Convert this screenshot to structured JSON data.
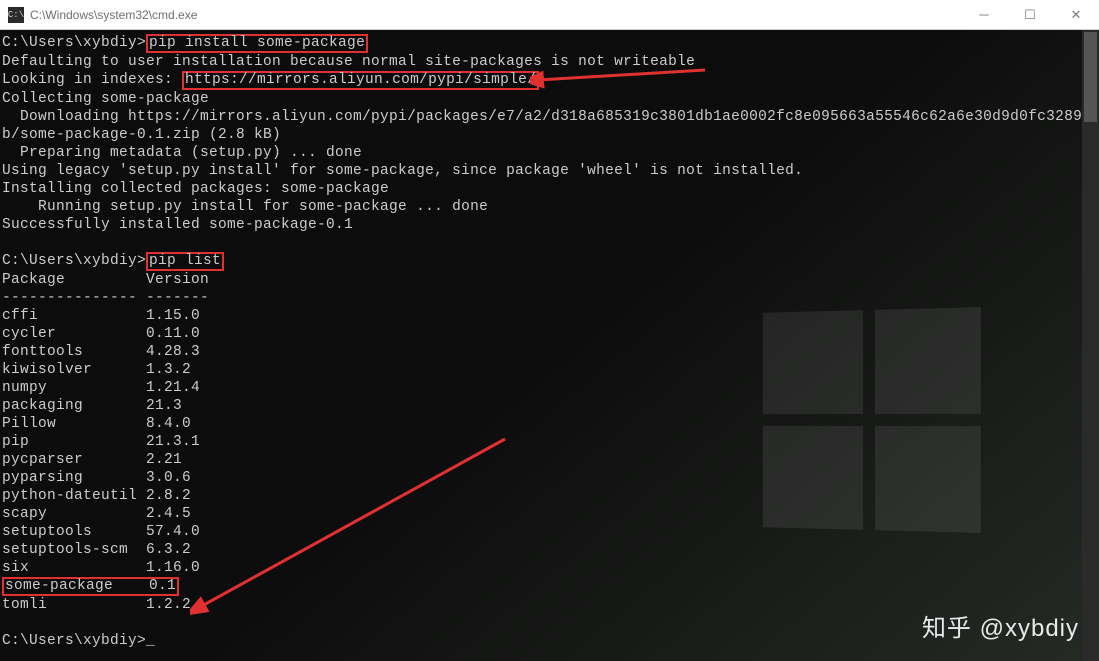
{
  "window": {
    "title": "C:\\Windows\\system32\\cmd.exe",
    "icon_label": "C:\\"
  },
  "prompt": "C:\\Users\\xybdiy>",
  "commands": {
    "install": "pip install some-package",
    "list": "pip list"
  },
  "output": {
    "install": {
      "line1": "Defaulting to user installation because normal site-packages is not writeable",
      "looking_prefix": "Looking in indexes: ",
      "index_url": "https://mirrors.aliyun.com/pypi/simple/",
      "collecting": "Collecting some-package",
      "downloading": "  Downloading https://mirrors.aliyun.com/pypi/packages/e7/a2/d318a685319c3801db1ae0002fc8e095663a55546c62a6e30d9d0fc3289",
      "downloading2": "b/some-package-0.1.zip (2.8 kB)",
      "preparing": "  Preparing metadata (setup.py) ... done",
      "legacy": "Using legacy 'setup.py install' for some-package, since package 'wheel' is not installed.",
      "installing": "Installing collected packages: some-package",
      "running": "    Running setup.py install for some-package ... done",
      "success": "Successfully installed some-package-0.1"
    },
    "list": {
      "header": "Package         Version",
      "divider": "--------------- -------",
      "packages": [
        {
          "name": "cffi",
          "ver": "1.15.0"
        },
        {
          "name": "cycler",
          "ver": "0.11.0"
        },
        {
          "name": "fonttools",
          "ver": "4.28.3"
        },
        {
          "name": "kiwisolver",
          "ver": "1.3.2"
        },
        {
          "name": "numpy",
          "ver": "1.21.4"
        },
        {
          "name": "packaging",
          "ver": "21.3"
        },
        {
          "name": "Pillow",
          "ver": "8.4.0"
        },
        {
          "name": "pip",
          "ver": "21.3.1"
        },
        {
          "name": "pycparser",
          "ver": "2.21"
        },
        {
          "name": "pyparsing",
          "ver": "3.0.6"
        },
        {
          "name": "python-dateutil",
          "ver": "2.8.2"
        },
        {
          "name": "scapy",
          "ver": "2.4.5"
        },
        {
          "name": "setuptools",
          "ver": "57.4.0"
        },
        {
          "name": "setuptools-scm",
          "ver": "6.3.2"
        },
        {
          "name": "six",
          "ver": "1.16.0"
        },
        {
          "name": "some-package",
          "ver": "0.1",
          "highlight": true
        },
        {
          "name": "tomli",
          "ver": "1.2.2"
        }
      ]
    }
  },
  "watermark": "知乎 @xybdiy"
}
